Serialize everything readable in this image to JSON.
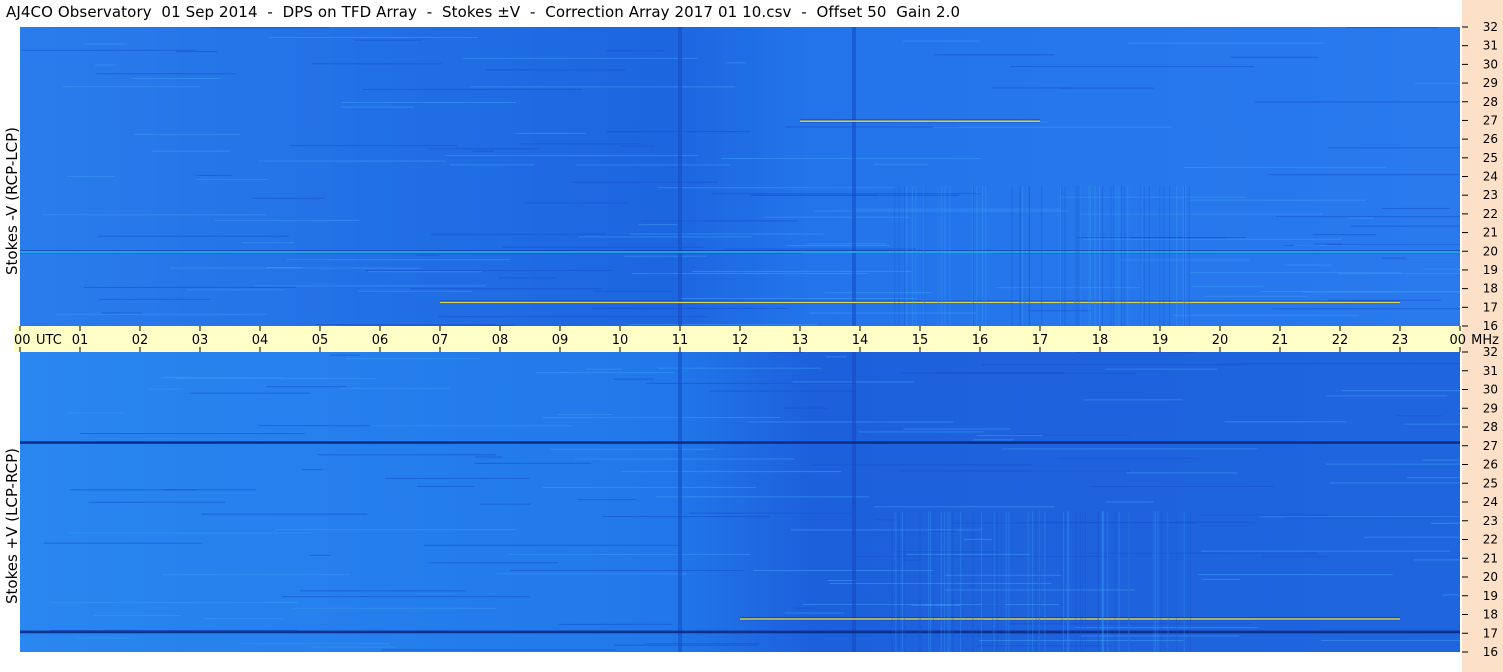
{
  "title": "AJ4CO Observatory  01 Sep 2014  -  DPS on TFD Array  -  Stokes ±V  -  Correction Array 2017 01 10.csv  -  Offset 50  Gain 2.0",
  "panels": [
    {
      "ylabel": "Stokes -V (RCP-LCP)"
    },
    {
      "ylabel": "Stokes +V (LCP-RCP)"
    }
  ],
  "time_axis": {
    "labels": [
      "00",
      "01",
      "02",
      "03",
      "04",
      "05",
      "06",
      "07",
      "08",
      "09",
      "10",
      "11",
      "12",
      "13",
      "14",
      "15",
      "16",
      "17",
      "18",
      "19",
      "20",
      "21",
      "22",
      "23",
      "00"
    ],
    "utc_label": "UTC",
    "unit_label": "MHz"
  },
  "colors": {
    "background_blue": "#1f6fe8",
    "dark_blue": "#1848c8",
    "cyan": "#2ed3ff",
    "yellow": "#ffee44",
    "axis_band": "#ffffc8",
    "right_strip": "#fde0c8"
  },
  "chart_data": [
    {
      "type": "heatmap",
      "title": "Stokes -V (RCP-LCP)",
      "x": {
        "label": "UTC",
        "range": [
          0,
          24
        ],
        "ticks": [
          0,
          1,
          2,
          3,
          4,
          5,
          6,
          7,
          8,
          9,
          10,
          11,
          12,
          13,
          14,
          15,
          16,
          17,
          18,
          19,
          20,
          21,
          22,
          23,
          24
        ]
      },
      "y": {
        "label": "MHz",
        "range": [
          16,
          32
        ],
        "ticks": [
          16,
          17,
          18,
          19,
          20,
          21,
          22,
          23,
          24,
          25,
          26,
          27,
          28,
          29,
          30,
          31,
          32
        ]
      },
      "features": [
        {
          "kind": "vertical_stripe",
          "time": 11.0
        },
        {
          "kind": "vertical_stripe",
          "time": 13.9
        },
        {
          "kind": "band",
          "freq": 27.0,
          "time_range": [
            13,
            17
          ],
          "color": "yellow"
        },
        {
          "kind": "band",
          "freq": 17.3,
          "time_range": [
            7,
            23
          ],
          "color": "yellow"
        },
        {
          "kind": "band",
          "freq": 20.0,
          "time_range": [
            0,
            24
          ],
          "color": "cyan"
        }
      ]
    },
    {
      "type": "heatmap",
      "title": "Stokes +V (LCP-RCP)",
      "x": {
        "label": "UTC",
        "range": [
          0,
          24
        ],
        "ticks": [
          0,
          1,
          2,
          3,
          4,
          5,
          6,
          7,
          8,
          9,
          10,
          11,
          12,
          13,
          14,
          15,
          16,
          17,
          18,
          19,
          20,
          21,
          22,
          23,
          24
        ]
      },
      "y": {
        "label": "MHz",
        "range": [
          16,
          32
        ],
        "ticks": [
          16,
          17,
          18,
          19,
          20,
          21,
          22,
          23,
          24,
          25,
          26,
          27,
          28,
          29,
          30,
          31,
          32
        ]
      },
      "features": [
        {
          "kind": "vertical_stripe",
          "time": 11.0
        },
        {
          "kind": "vertical_stripe",
          "time": 13.9
        },
        {
          "kind": "band",
          "freq": 27.2,
          "time_range": [
            0,
            24
          ],
          "color": "dark"
        },
        {
          "kind": "band",
          "freq": 17.8,
          "time_range": [
            12,
            23
          ],
          "color": "yellow"
        },
        {
          "kind": "band",
          "freq": 17.1,
          "time_range": [
            0,
            24
          ],
          "color": "dark"
        }
      ]
    }
  ]
}
